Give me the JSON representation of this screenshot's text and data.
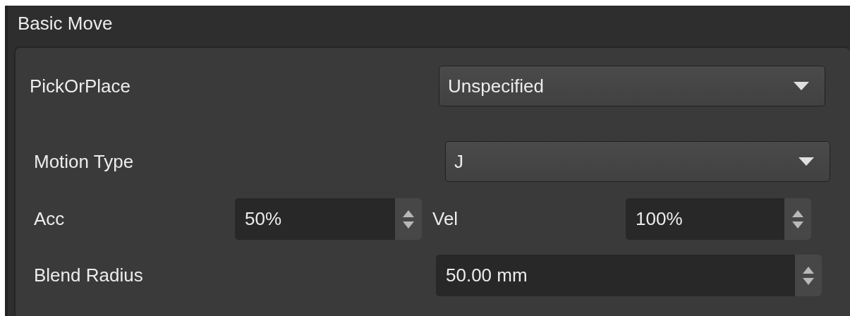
{
  "panel": {
    "title": "Basic Move"
  },
  "rows": [
    {
      "kind": "dropdown",
      "label": "PickOrPlace",
      "value": "Unspecified"
    },
    {
      "kind": "dropdown",
      "label": "Motion Type",
      "value": "J"
    },
    {
      "kind": "spin-pair",
      "label": "Acc",
      "value": "50%",
      "label_2": "Vel",
      "value_2": "100%"
    },
    {
      "kind": "spin",
      "label": "Blend Radius",
      "value": "50.00 mm"
    }
  ]
}
